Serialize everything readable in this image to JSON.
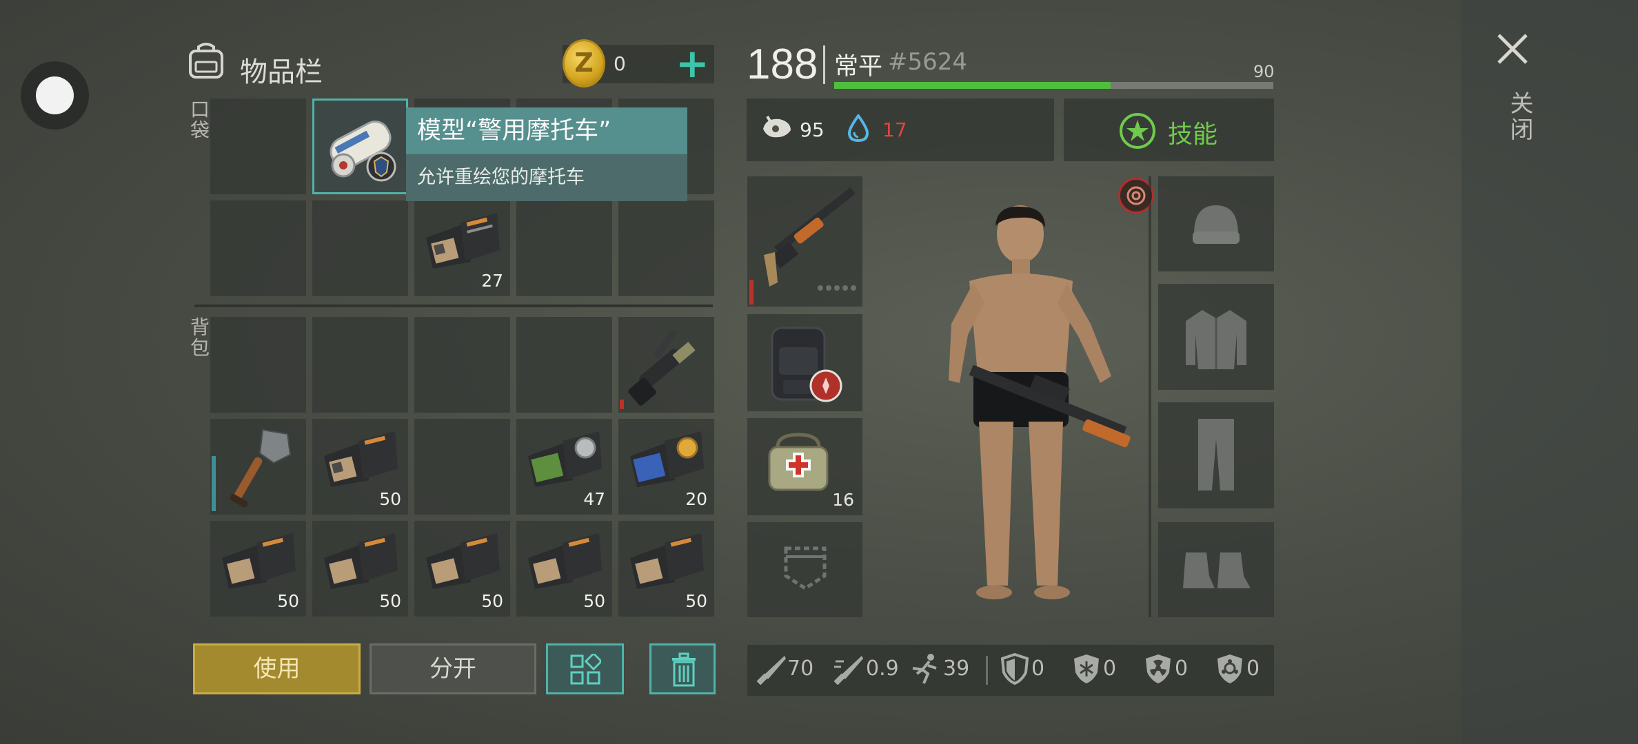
{
  "inventory": {
    "title": "物品栏",
    "pockets_label": "口袋",
    "backpack_label": "背包",
    "coins": "0",
    "coin_symbol": "Z",
    "counts": {
      "p2_3": "27",
      "b2_2": "50",
      "b2_4": "47",
      "b2_5": "20",
      "b3_1": "50",
      "b3_2": "50",
      "b3_3": "50",
      "b3_4": "50",
      "b3_5": "50"
    }
  },
  "tooltip": {
    "title": "模型“警用摩托车”",
    "description": "允许重绘您的摩托车"
  },
  "actions": {
    "use": "使用",
    "split": "分开"
  },
  "character": {
    "level": "188",
    "name": "常平",
    "id": "#5624",
    "xp_max": "90",
    "xp_fraction": 0.63,
    "food": "95",
    "water": "17",
    "skills_label": "技能",
    "medkit_count": "16"
  },
  "stats": {
    "attack": "70",
    "attack_speed": "0.9",
    "speed": "39",
    "armor": "0",
    "cold": "0",
    "radiation": "0",
    "toxic": "0"
  },
  "close_label": "关闭",
  "colors": {
    "accent": "#4fb3a8",
    "use_button": "#a48a2e",
    "xp_bar": "#4fbe3c",
    "water_low": "#e8423a",
    "skill_green": "#6fcb4c"
  }
}
